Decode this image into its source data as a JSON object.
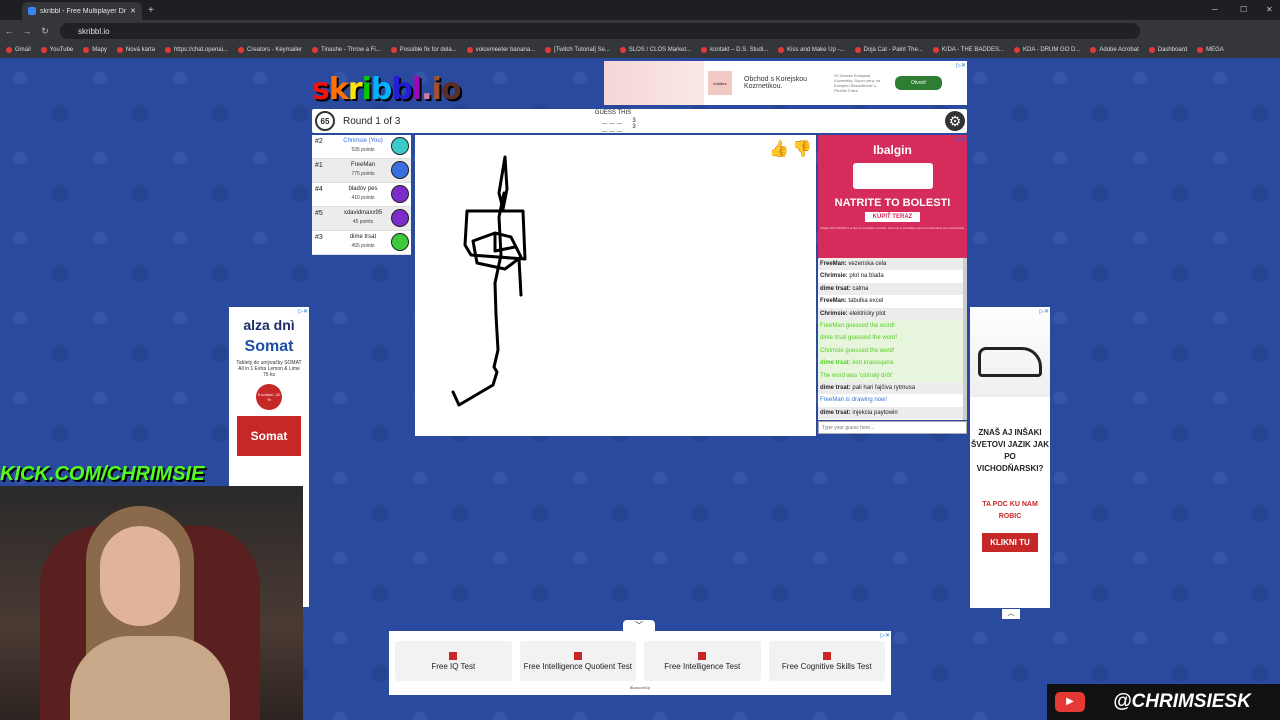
{
  "browser": {
    "tab_title": "skribbl - Free Multiplayer Drawi...",
    "url": "skribbl.io",
    "bookmarks": [
      "Gmail",
      "YouTube",
      "Mapy",
      "Nová karta",
      "https://chat.openai...",
      "Creators - Keymailer",
      "Tinashe - Throw a Fi...",
      "Possible fix for dela...",
      "voicemeeter banana...",
      "[Twitch Tutorial] Se...",
      "SLOS / CLOS Market...",
      "kontakt – D.S. Studi...",
      "Kiss and Make Up -...",
      "Doja Cat - Paint The...",
      "K/DA - THE BADDES...",
      "KDA - DRUM GO D...",
      "Adobe Acrobat",
      "Dashboard",
      "MEGA"
    ]
  },
  "logo": "skribbl.io",
  "logo_colors": [
    "#ef130b",
    "#ff7100",
    "#ffe400",
    "#00cc00",
    "#00b2ff",
    "#231fd3",
    "#a300ba",
    "#d37caa",
    "#a0522d",
    "#592f2a"
  ],
  "top_ad": {
    "brand": "kolders",
    "text": "Obchod s Korejskou Kozmetikou.",
    "small": "29 Znacek Kórejskej Kozmetiky. Super ceny na Kórejskú Starostlivosť o Pleťdla Tvare",
    "button": "Otvoriť"
  },
  "game": {
    "timer": "65",
    "round": "Round 1 of 3",
    "guess_label": "GUESS THIS",
    "word_hint": "___ ___",
    "word_lengths": "3 3"
  },
  "players": [
    {
      "rank": "#2",
      "name": "Chrimsie (You)",
      "points": "535 points",
      "color": "#3cc9c9",
      "me": true
    },
    {
      "rank": "#1",
      "name": "FreeMan",
      "points": "775 points",
      "color": "#3a6fe0",
      "me": false
    },
    {
      "rank": "#4",
      "name": "bladov pes",
      "points": "410 points",
      "color": "#7b2cc9",
      "me": false
    },
    {
      "rank": "#5",
      "name": "xdavidmaxx95",
      "points": "45 points",
      "color": "#7b2cc9",
      "me": false
    },
    {
      "rank": "#3",
      "name": "dime trsat",
      "points": "455 points",
      "color": "#3cc93c",
      "me": false
    }
  ],
  "right_ad": {
    "brand": "Ibalgin",
    "headline": "NATRITE TO BOLESTI",
    "button": "KÚPIŤ TERAZ",
    "fine": "Ibalgin DUO EFFECT je liek na vonkajšie použitie. Pozorne si prečítajte písomnú informáciu pre používateľa."
  },
  "chat": [
    {
      "who": "FreeMan:",
      "text": "vezenska cela",
      "style": "alt"
    },
    {
      "who": "Chrimsie:",
      "text": "plot na blada",
      "style": ""
    },
    {
      "who": "dime trsat:",
      "text": "calma",
      "style": "alt"
    },
    {
      "who": "FreeMan:",
      "text": "tabulka excel",
      "style": ""
    },
    {
      "who": "Chrimsie:",
      "text": "elektricky plot",
      "style": "alt"
    },
    {
      "who": "",
      "text": "FreeMan guessed the word!",
      "style": "green"
    },
    {
      "who": "",
      "text": "dime trsat guessed the word!",
      "style": "green"
    },
    {
      "who": "",
      "text": "Chrimsie guessed the word!",
      "style": "green"
    },
    {
      "who": "dime trsat:",
      "text": "kon krasoujana",
      "style": "green"
    },
    {
      "who": "",
      "text": "The word was 'ostnatý drôt'",
      "style": "green"
    },
    {
      "who": "dime trsat:",
      "text": "pali hari fajčiva rytmusa",
      "style": "alt"
    },
    {
      "who": "",
      "text": "FreeMan is drawing now!",
      "style": "blue"
    },
    {
      "who": "dime trsat:",
      "text": "injekcia paytowin",
      "style": "alt"
    }
  ],
  "chat_placeholder": "Type your guess here...",
  "left_ad": {
    "brand": "alza dnì",
    "product": "Somat",
    "desc": "Tablety do umývačky SOMAT All in 1 Extra Lemon & Lime 75 ks",
    "badge": "S kódom -20 %",
    "pack": "Somat"
  },
  "kick_text": "KICK.COM/CHRIMSIE",
  "right_banner": {
    "question": "ZNAŠ AJ INŠAKI ŠVETOVI JAZIK JAK PO VICHODŇARSKI?",
    "cta": "TA POC KU NAM ROBIC",
    "button": "KLIKNI TU"
  },
  "bottom_ad": {
    "buttons": [
      "Free IQ Test",
      "Free Intelligence Quotient Test",
      "Free Intelligence Test",
      "Free Cognitive Skills Test"
    ],
    "sponsor": "BlossomUp"
  },
  "youtube_handle": "@CHRIMSIESK"
}
